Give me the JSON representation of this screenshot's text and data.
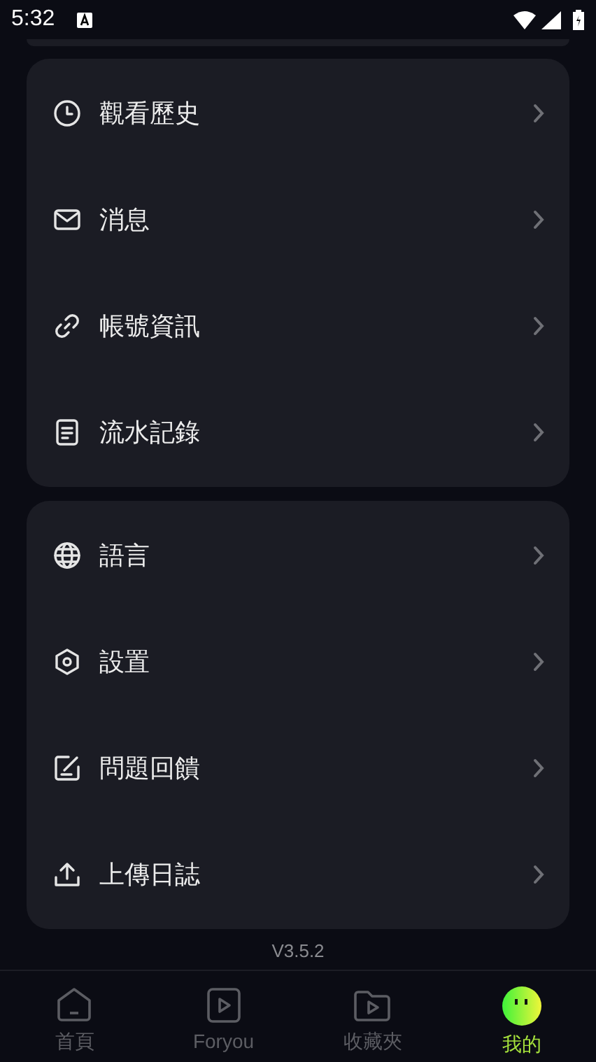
{
  "status_bar": {
    "time": "5:32"
  },
  "menu_groups": [
    {
      "items": [
        {
          "kind": "clock",
          "label": "觀看歷史"
        },
        {
          "kind": "mail",
          "label": "消息"
        },
        {
          "kind": "link",
          "label": "帳號資訊"
        },
        {
          "kind": "document",
          "label": "流水記錄"
        }
      ]
    },
    {
      "items": [
        {
          "kind": "globe",
          "label": "語言"
        },
        {
          "kind": "hexagon",
          "label": "設置"
        },
        {
          "kind": "edit",
          "label": "問題回饋"
        },
        {
          "kind": "upload",
          "label": "上傳日誌"
        }
      ]
    }
  ],
  "version": "V3.5.2",
  "bottom_nav": [
    {
      "kind": "home",
      "label": "首頁",
      "selected": false
    },
    {
      "kind": "play",
      "label": "Foryou",
      "selected": false
    },
    {
      "kind": "folder",
      "label": "收藏夾",
      "selected": false
    },
    {
      "kind": "avatar",
      "label": "我的",
      "selected": true
    }
  ]
}
